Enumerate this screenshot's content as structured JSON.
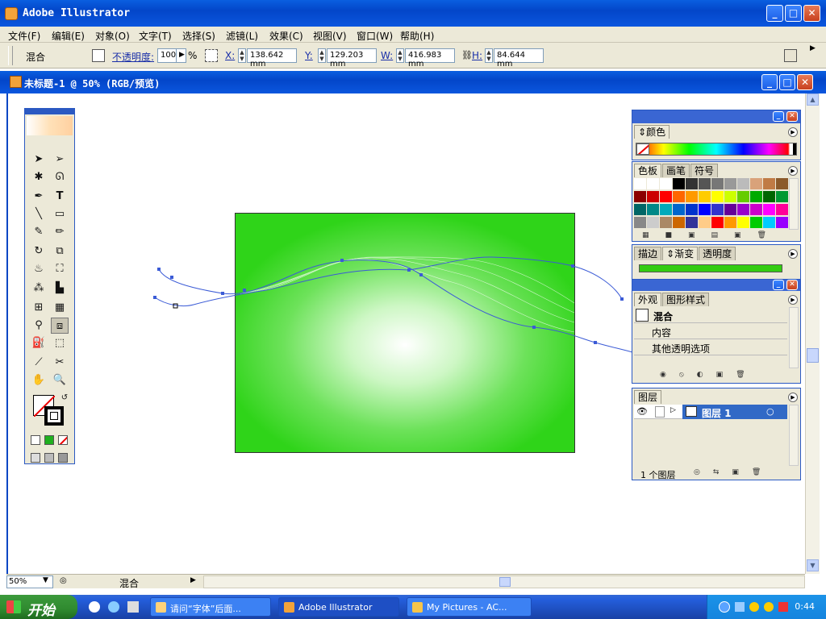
{
  "app": {
    "title": "Adobe Illustrator"
  },
  "menu": [
    "文件(F)",
    "编辑(E)",
    "对象(O)",
    "文字(T)",
    "选择(S)",
    "滤镜(L)",
    "效果(C)",
    "视图(V)",
    "窗口(W)",
    "帮助(H)"
  ],
  "options": {
    "mode": "混合",
    "opacity_label": "不透明度:",
    "opacity_value": "100",
    "percent": "%",
    "x_label": "X:",
    "x_value": "138.642 mm",
    "y_label": "Y:",
    "y_value": "129.203 mm",
    "w_label": "W:",
    "w_value": "416.983 mm",
    "h_label": "H:",
    "h_value": "84.644 mm"
  },
  "document": {
    "title": "未标题-1 @ 50% (RGB/预览)"
  },
  "status": {
    "zoom": "50%",
    "text": "混合"
  },
  "panels": {
    "color": {
      "tab": "颜色"
    },
    "swatches": {
      "tabs": [
        "色板",
        "画笔",
        "符号"
      ]
    },
    "stroke": {
      "tabs": [
        "描边",
        "渐变",
        "透明度"
      ]
    },
    "appearance": {
      "tabs": [
        "外观",
        "图形样式"
      ],
      "item": "混合",
      "rows": [
        "内容",
        "其他透明选项"
      ]
    },
    "layers": {
      "tab": "图层",
      "layer": "图层 1",
      "footer": "1 个图层"
    }
  },
  "colors": {
    "accent": "#0a5fe0",
    "art_green": "#2fd419",
    "gradient_bar": "#33cc11"
  },
  "taskbar": {
    "start": "开始",
    "tasks": [
      "请问“字体”后面...",
      "Adobe Illustrator",
      "My Pictures - AC..."
    ],
    "clock": "0:44"
  }
}
